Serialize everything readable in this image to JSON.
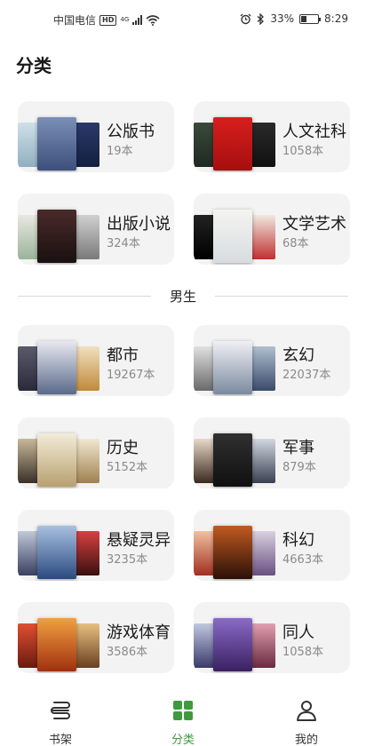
{
  "status": {
    "carrier": "中国电信",
    "hd": "HD",
    "net": "4G",
    "battery_percent_label": "33%",
    "battery_level": 0.33,
    "time": "8:29"
  },
  "page_title": "分类",
  "section_male": "男生",
  "colors": {
    "card_bg": "#f3f3f3",
    "accent_green": "#3f9a3f",
    "count_gray": "#8a8a8a"
  },
  "categories_top": [
    {
      "name": "公版书",
      "count": "19本"
    },
    {
      "name": "人文社科",
      "count": "1058本"
    },
    {
      "name": "出版小说",
      "count": "324本"
    },
    {
      "name": "文学艺术",
      "count": "68本"
    }
  ],
  "categories_male": [
    {
      "name": "都市",
      "count": "19267本"
    },
    {
      "name": "玄幻",
      "count": "22037本"
    },
    {
      "name": "历史",
      "count": "5152本"
    },
    {
      "name": "军事",
      "count": "879本"
    },
    {
      "name": "悬疑灵异",
      "count": "3235本"
    },
    {
      "name": "科幻",
      "count": "4663本"
    },
    {
      "name": "游戏体育",
      "count": "3586本"
    },
    {
      "name": "同人",
      "count": "1058本"
    }
  ],
  "tabs": [
    {
      "label": "书架",
      "icon": "bookshelf-icon"
    },
    {
      "label": "分类",
      "icon": "category-grid-icon",
      "active": true
    },
    {
      "label": "我的",
      "icon": "profile-icon"
    }
  ]
}
